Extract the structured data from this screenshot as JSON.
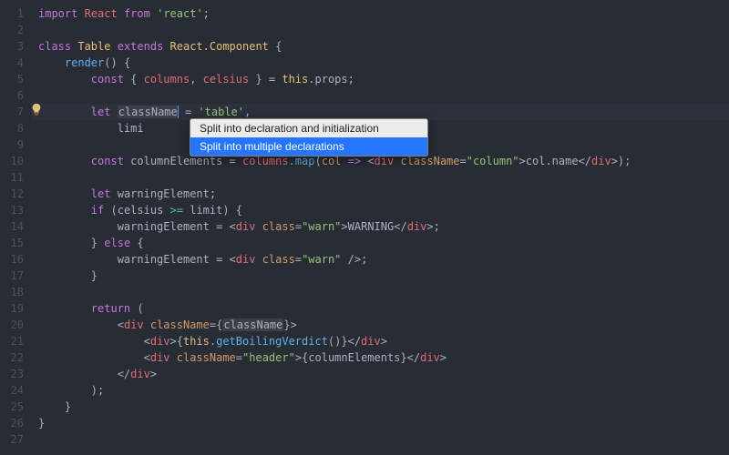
{
  "lines": {
    "count": 27,
    "highlight": 7
  },
  "code": {
    "l1_import": "import",
    "l1_default": "React",
    "l1_from": "from",
    "l1_pkg": "'react'",
    "l3_class": "class",
    "l3_name": "Table",
    "l3_extends": "extends",
    "l3_super": "React.Component",
    "l4_render": "render",
    "l5_const": "const",
    "l5_destruct_open": "{ ",
    "l5_c1": "columns",
    "l5_sep": ", ",
    "l5_c2": "celsius",
    "l5_destruct_close": " }",
    "l5_eq": " = ",
    "l5_this": "this",
    "l5_props": ".props",
    "l7_let": "let",
    "l7_name": "className",
    "l7_eq": " = ",
    "l7_val": "'table'",
    "l8_name": "limi",
    "l10_const": "const",
    "l10_name": "columnElements",
    "l10_eq": " = ",
    "l10_cols": "columns",
    "l10_map": ".map",
    "l10_param": "col",
    "l10_arrow": " => ",
    "l10_tag": "div",
    "l10_attr": "className",
    "l10_attrval": "\"column\"",
    "l10_inner": "col.name",
    "l12_let": "let",
    "l12_name": "warningElement",
    "l13_if": "if",
    "l13_lhs": "celsius",
    "l13_op": " >= ",
    "l13_rhs": "limit",
    "l14_lhs": "warningElement",
    "l14_tag": "div",
    "l14_attr": "class",
    "l14_attrval": "\"warn\"",
    "l14_text": "WARNING",
    "l15_else": "else",
    "l16_lhs": "warningElement",
    "l16_tag": "div",
    "l16_attr": "class",
    "l16_attrval": "\"warn\"",
    "l19_return": "return",
    "l20_tag": "div",
    "l20_attr": "className",
    "l20_val": "className",
    "l21_tag": "div",
    "l21_this": "this",
    "l21_call": ".getBoilingVerdict",
    "l22_tag": "div",
    "l22_attr": "className",
    "l22_attrval": "\"header\"",
    "l22_inner": "columnElements"
  },
  "intention": {
    "item1": "Split into declaration and initialization",
    "item2": "Split into multiple declarations"
  },
  "icons": {
    "bulb": "lightbulb-icon"
  }
}
